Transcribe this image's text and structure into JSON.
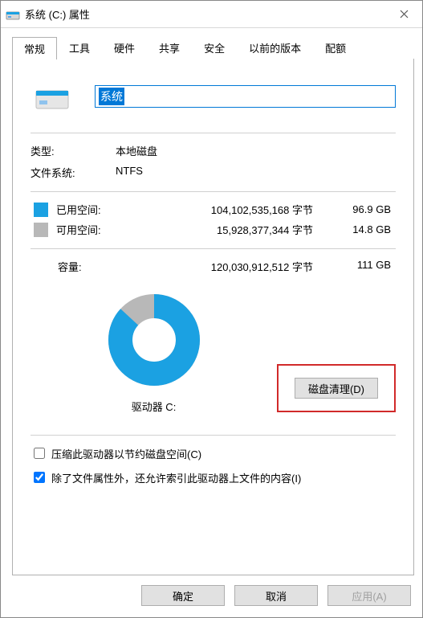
{
  "window": {
    "title": "系统 (C:) 属性"
  },
  "tabs": {
    "t0": "常规",
    "t1": "工具",
    "t2": "硬件",
    "t3": "共享",
    "t4": "安全",
    "t5": "以前的版本",
    "t6": "配额"
  },
  "drive": {
    "name": "系统",
    "type_label": "类型:",
    "type_value": "本地磁盘",
    "fs_label": "文件系统:",
    "fs_value": "NTFS"
  },
  "space": {
    "used_label": "已用空间:",
    "used_bytes": "104,102,535,168 字节",
    "used_gb": "96.9 GB",
    "free_label": "可用空间:",
    "free_bytes": "15,928,377,344 字节",
    "free_gb": "14.8 GB",
    "cap_label": "容量:",
    "cap_bytes": "120,030,912,512 字节",
    "cap_gb": "111 GB"
  },
  "chart_data": {
    "type": "pie",
    "title": "驱动器 C:",
    "series": [
      {
        "name": "已用空间",
        "value": 104102535168,
        "color": "#1ba1e2"
      },
      {
        "name": "可用空间",
        "value": 15928377344,
        "color": "#b8b8b8"
      }
    ]
  },
  "donut": {
    "label": "驱动器 C:"
  },
  "buttons": {
    "cleanup": "磁盘清理(D)",
    "ok": "确定",
    "cancel": "取消",
    "apply": "应用(A)"
  },
  "options": {
    "compress": "压缩此驱动器以节约磁盘空间(C)",
    "index": "除了文件属性外，还允许索引此驱动器上文件的内容(I)"
  }
}
